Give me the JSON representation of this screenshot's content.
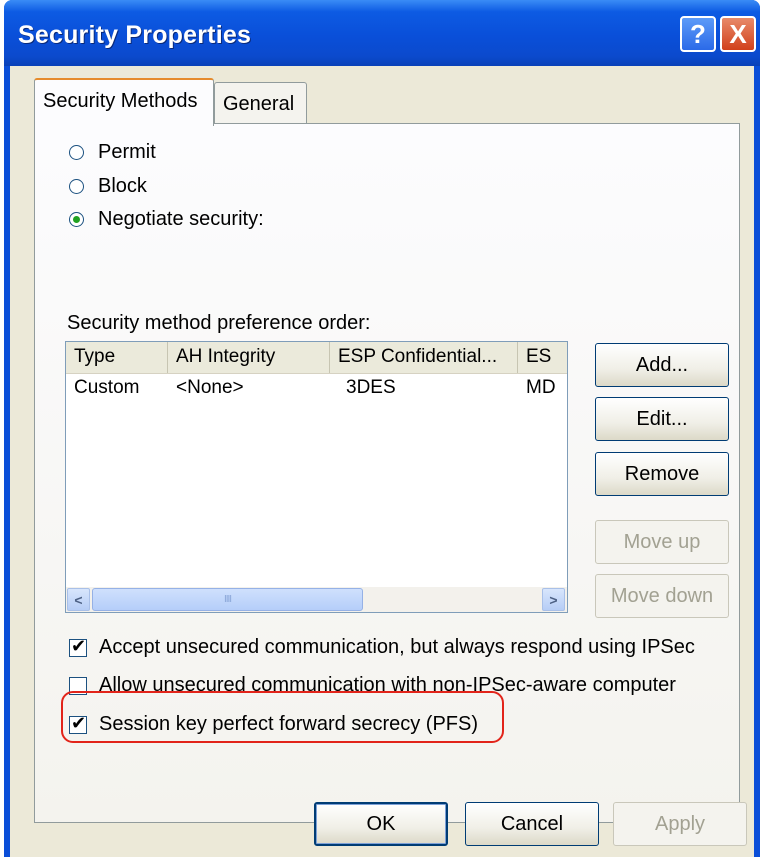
{
  "window": {
    "title": "Security Properties"
  },
  "tabs": [
    {
      "label": "Security Methods"
    },
    {
      "label": "General"
    }
  ],
  "radios": [
    {
      "label": "Permit",
      "checked": false
    },
    {
      "label": "Block",
      "checked": false
    },
    {
      "label": "Negotiate security:",
      "checked": true
    }
  ],
  "list": {
    "label": "Security method preference order:",
    "columns": [
      "Type",
      "AH Integrity",
      "ESP Confidential...",
      "ES"
    ],
    "rows": [
      [
        "Custom",
        "<None>",
        "3DES",
        "MD"
      ]
    ],
    "scroll_grip": "IIII"
  },
  "side_buttons": {
    "add": "Add...",
    "edit": "Edit...",
    "remove": "Remove",
    "move_up": "Move up",
    "move_down": "Move down"
  },
  "checkboxes": [
    {
      "label": "Accept unsecured communication, but always respond using IPSec",
      "checked": true
    },
    {
      "label": "Allow unsecured communication with non-IPSec-aware computer",
      "checked": false
    },
    {
      "label": "Session key perfect forward secrecy (PFS)",
      "checked": true
    }
  ],
  "footer": {
    "ok": "OK",
    "cancel": "Cancel",
    "apply": "Apply"
  },
  "colors": {
    "titlebar": "#0a4fd9",
    "face": "#ece9d8",
    "highlight": "#e2241a"
  },
  "icons": {
    "help": "?",
    "close": "X",
    "left": "<",
    "right": ">"
  }
}
